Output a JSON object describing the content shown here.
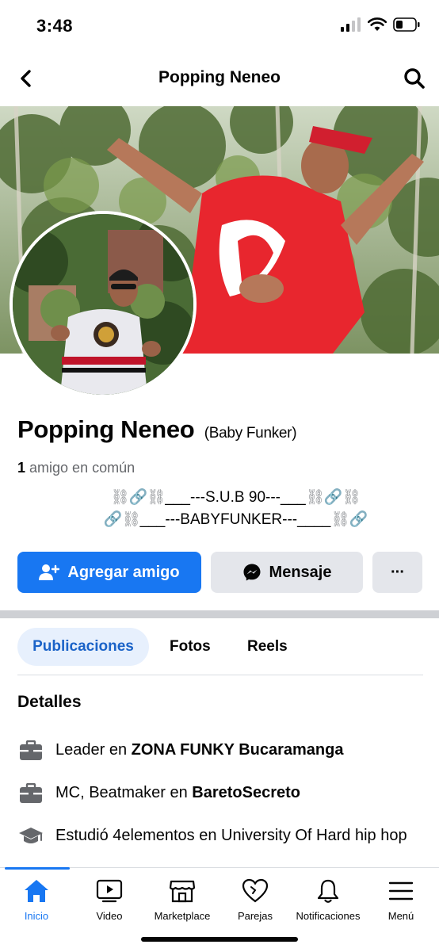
{
  "status_bar": {
    "time": "3:48"
  },
  "nav": {
    "title": "Popping Neneo"
  },
  "profile": {
    "name": "Popping Neneo",
    "alt_name": "(Baby Funker)",
    "mutual_count": "1",
    "mutual_text": "amigo en común",
    "bio_line1_deco_left": "⛓🔗⛓",
    "bio_line1_text": "___---S.U.B 90---___",
    "bio_line1_deco_right": "⛓🔗⛓",
    "bio_line2_deco_left": "🔗⛓",
    "bio_line2_text": "___---BABYFUNKER---____",
    "bio_line2_deco_right": "⛓🔗"
  },
  "actions": {
    "add_friend": "Agregar amigo",
    "message": "Mensaje",
    "more": "···"
  },
  "tabs": [
    {
      "label": "Publicaciones",
      "active": true
    },
    {
      "label": "Fotos",
      "active": false
    },
    {
      "label": "Reels",
      "active": false
    }
  ],
  "details": {
    "title": "Detalles",
    "items": [
      {
        "icon": "briefcase-icon",
        "prefix": "Leader en ",
        "bold": "ZONA FUNKY Bucaramanga"
      },
      {
        "icon": "briefcase-icon",
        "prefix": "MC, Beatmaker en ",
        "bold": "BaretoSecreto"
      },
      {
        "icon": "graduation-cap-icon",
        "prefix": "Estudió 4elementos en University Of Hard hip hop",
        "bold": ""
      }
    ]
  },
  "bottom_nav": [
    {
      "label": "Inicio",
      "icon": "home-icon",
      "active": true
    },
    {
      "label": "Video",
      "icon": "video-icon",
      "active": false
    },
    {
      "label": "Marketplace",
      "icon": "marketplace-icon",
      "active": false
    },
    {
      "label": "Parejas",
      "icon": "heart-icon",
      "active": false
    },
    {
      "label": "Notificaciones",
      "icon": "bell-icon",
      "active": false
    },
    {
      "label": "Menú",
      "icon": "menu-icon",
      "active": false
    }
  ],
  "colors": {
    "accent": "#1877f2",
    "tab_active_bg": "#e7f0fd",
    "button_gray": "#e4e6eb"
  }
}
